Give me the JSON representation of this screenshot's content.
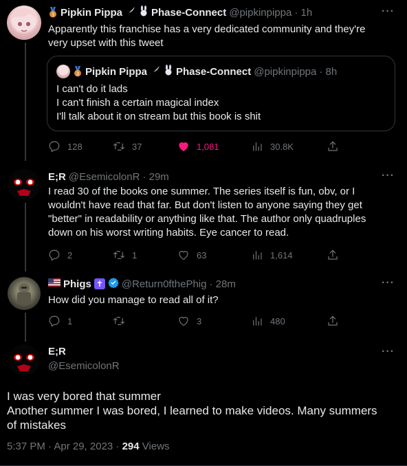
{
  "colors": {
    "background": "#000000",
    "text": "#e7e9ea",
    "muted": "#71767b",
    "like": "#f91880",
    "border": "#333639"
  },
  "tweets": [
    {
      "name": "Pipkin Pippa",
      "name_suffix": "Phase-Connect",
      "handle": "@pipkinpippa",
      "time": "· 1h",
      "text": "Apparently this franchise has a very dedicated community and they're\nvery upset with this tweet",
      "quote": {
        "name": "Pipkin Pippa",
        "name_suffix": "Phase-Connect",
        "handle": "@pipkinpippa",
        "time": "· 8h",
        "text": "I can't do it lads\nI can't finish a certain magical index\nI'll talk about it on stream but this book is shit"
      },
      "actions": {
        "replies": "128",
        "retweets": "37",
        "likes": "1,081",
        "views": "30.8K"
      }
    },
    {
      "name": "E;R",
      "handle": "@EsemicolonR",
      "time": "· 29m",
      "text": "I read 30 of the books one summer. The series itself is fun, obv, or I\nwouldn't have read that far. But don't listen to anyone saying they get\n\"better\" in readability or anything like that. The author only quadruples\ndown on his worst writing habits. Eye cancer to read.",
      "actions": {
        "replies": "2",
        "retweets": "1",
        "likes": "63",
        "views": "1,614"
      }
    },
    {
      "name": "Phigs",
      "handle": "@Return0fthePhig",
      "time": "· 28m",
      "text": "How did you manage to read all of it?",
      "actions": {
        "replies": "1",
        "retweets": "",
        "likes": "3",
        "views": "480"
      }
    }
  ],
  "main": {
    "name": "E;R",
    "handle": "@EsemicolonR",
    "text": "I was very bored that summer\nAnother summer I was bored, I learned to make videos. Many summers\nof mistakes",
    "timestamp": "5:37 PM · Apr 29, 2023 · ",
    "views_count": "294",
    "views_label": " Views"
  },
  "icons": {
    "more": "more-icon",
    "reply": "reply-icon",
    "retweet": "retweet-icon",
    "like": "heart-icon",
    "views": "views-icon",
    "share": "share-icon",
    "medal": "medal-icon",
    "verified": "verified-icon"
  }
}
